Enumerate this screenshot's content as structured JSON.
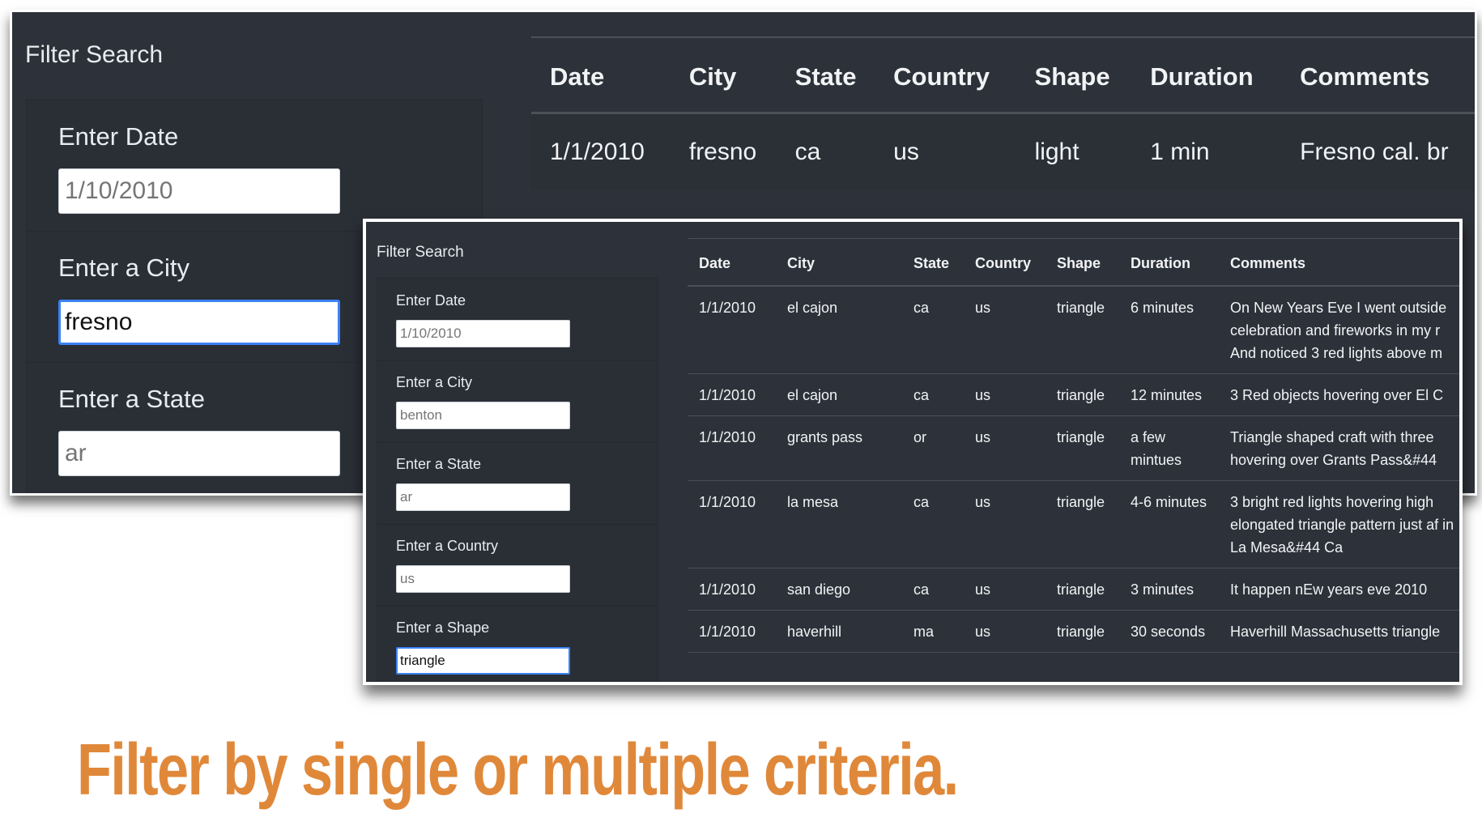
{
  "back": {
    "title": "Filter Search",
    "filters": [
      {
        "label": "Enter Date",
        "value": "",
        "placeholder": "1/10/2010"
      },
      {
        "label": "Enter a City",
        "value": "fresno",
        "placeholder": ""
      },
      {
        "label": "Enter a State",
        "value": "",
        "placeholder": "ar"
      }
    ],
    "columns": [
      "Date",
      "City",
      "State",
      "Country",
      "Shape",
      "Duration",
      "Comments"
    ],
    "rows": [
      [
        "1/1/2010",
        "fresno",
        "ca",
        "us",
        "light",
        "1 min",
        "Fresno cal. br"
      ]
    ]
  },
  "front": {
    "title": "Filter Search",
    "filters": [
      {
        "label": "Enter Date",
        "value": "",
        "placeholder": "1/10/2010"
      },
      {
        "label": "Enter a City",
        "value": "",
        "placeholder": "benton"
      },
      {
        "label": "Enter a State",
        "value": "",
        "placeholder": "ar"
      },
      {
        "label": "Enter a Country",
        "value": "",
        "placeholder": "us"
      },
      {
        "label": "Enter a Shape",
        "value": "triangle",
        "placeholder": ""
      }
    ],
    "columns": [
      "Date",
      "City",
      "State",
      "Country",
      "Shape",
      "Duration",
      "Comments"
    ],
    "rows": [
      [
        "1/1/2010",
        "el cajon",
        "ca",
        "us",
        "triangle",
        "6 minutes",
        "On New Years Eve I went outside celebration and fireworks in my r And noticed 3 red lights above m"
      ],
      [
        "1/1/2010",
        "el cajon",
        "ca",
        "us",
        "triangle",
        "12 minutes",
        "3 Red objects hovering over El C"
      ],
      [
        "1/1/2010",
        "grants pass",
        "or",
        "us",
        "triangle",
        "a few mintues",
        "Triangle shaped craft with three hovering over Grants Pass&#44"
      ],
      [
        "1/1/2010",
        "la mesa",
        "ca",
        "us",
        "triangle",
        "4-6 minutes",
        "3 bright red lights hovering high elongated triangle pattern just af in La Mesa&#44 Ca"
      ],
      [
        "1/1/2010",
        "san diego",
        "ca",
        "us",
        "triangle",
        "3 minutes",
        "It happen nEw years eve 2010"
      ],
      [
        "1/1/2010",
        "haverhill",
        "ma",
        "us",
        "triangle",
        "30 seconds",
        "Haverhill Massachusetts triangle"
      ]
    ]
  },
  "caption": "Filter by single or multiple criteria.",
  "colors": {
    "panel_bg": "#2d3139",
    "caption": "#e0883a",
    "focus": "#3b82f6"
  }
}
